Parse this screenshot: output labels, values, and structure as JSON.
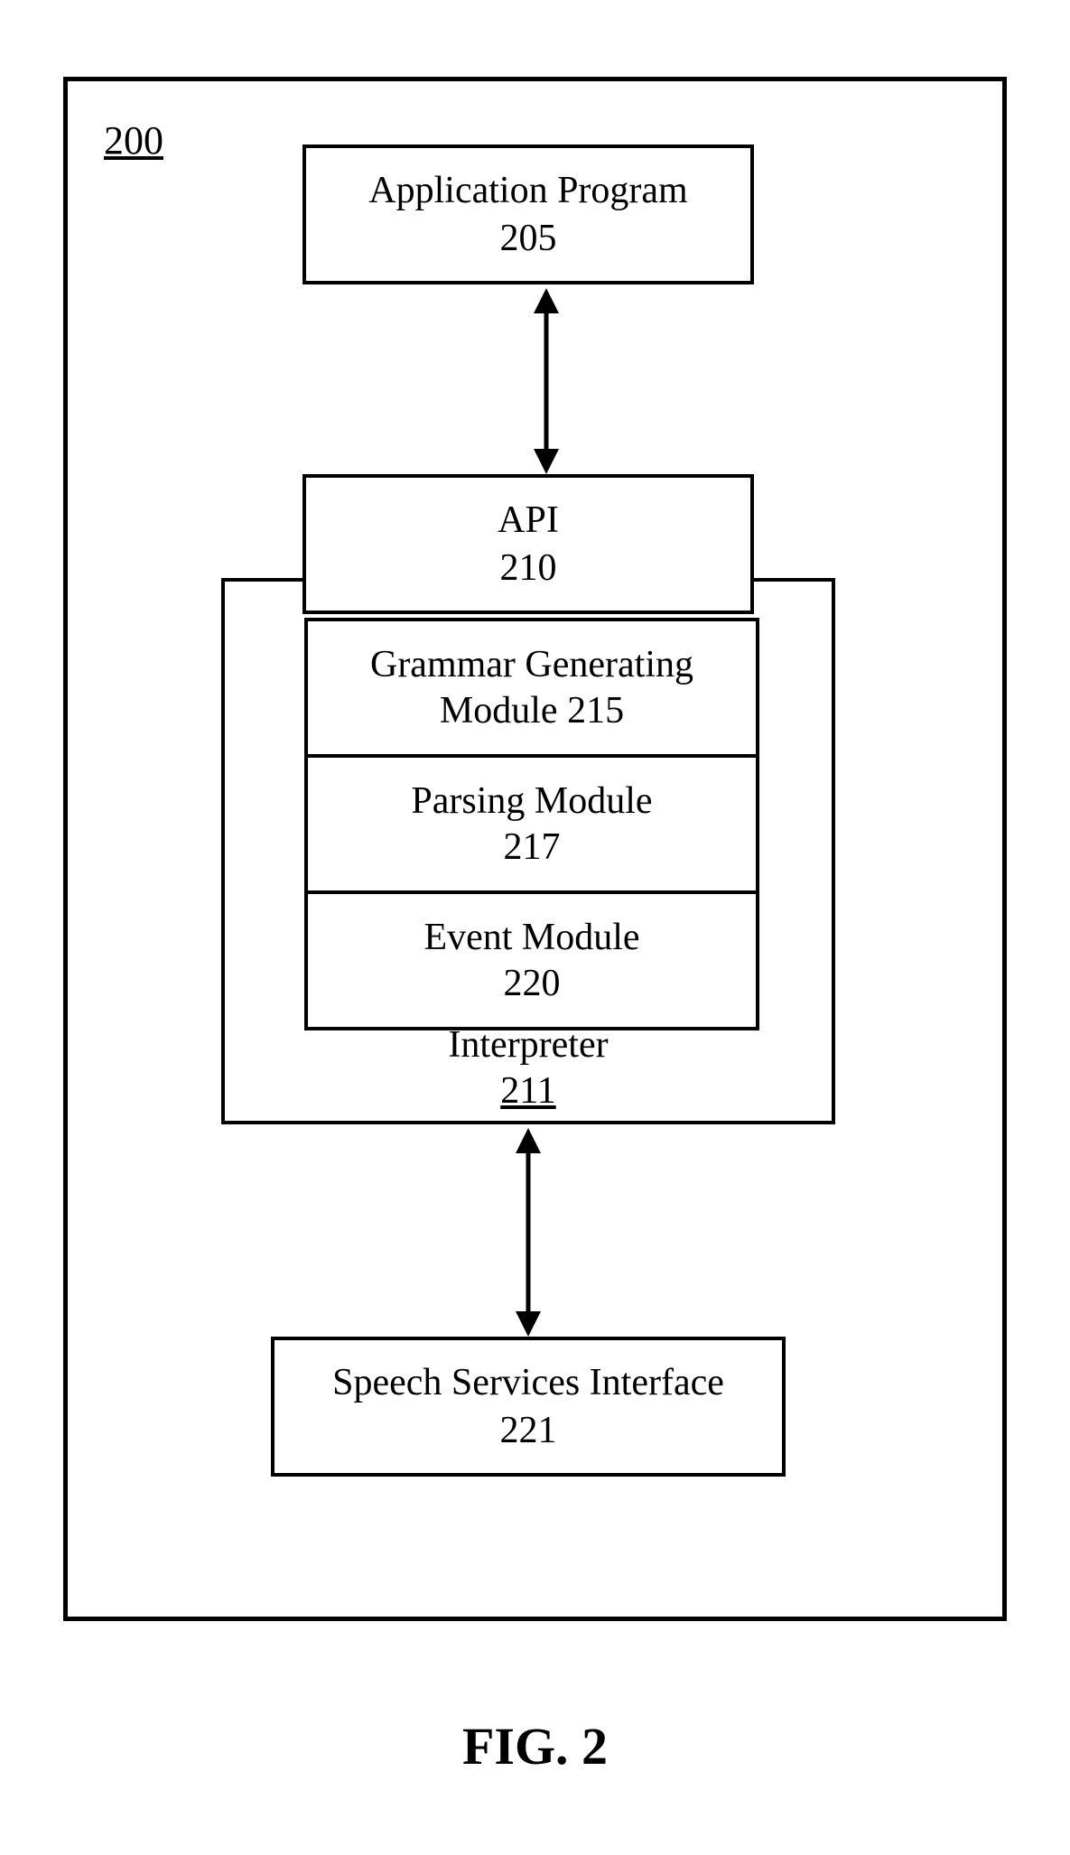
{
  "figure_ref": "200",
  "boxes": {
    "app": {
      "label": "Application Program",
      "num": "205"
    },
    "api": {
      "label": "API",
      "num": "210"
    },
    "interp": {
      "label": "Interpreter",
      "num": "211"
    },
    "grammar": {
      "label": "Grammar Generating",
      "label2": "Module 215"
    },
    "parsing": {
      "label": "Parsing Module",
      "num": "217"
    },
    "event": {
      "label": "Event Module",
      "num": "220"
    },
    "speech": {
      "label": "Speech Services Interface",
      "num": "221"
    }
  },
  "caption": "FIG. 2"
}
